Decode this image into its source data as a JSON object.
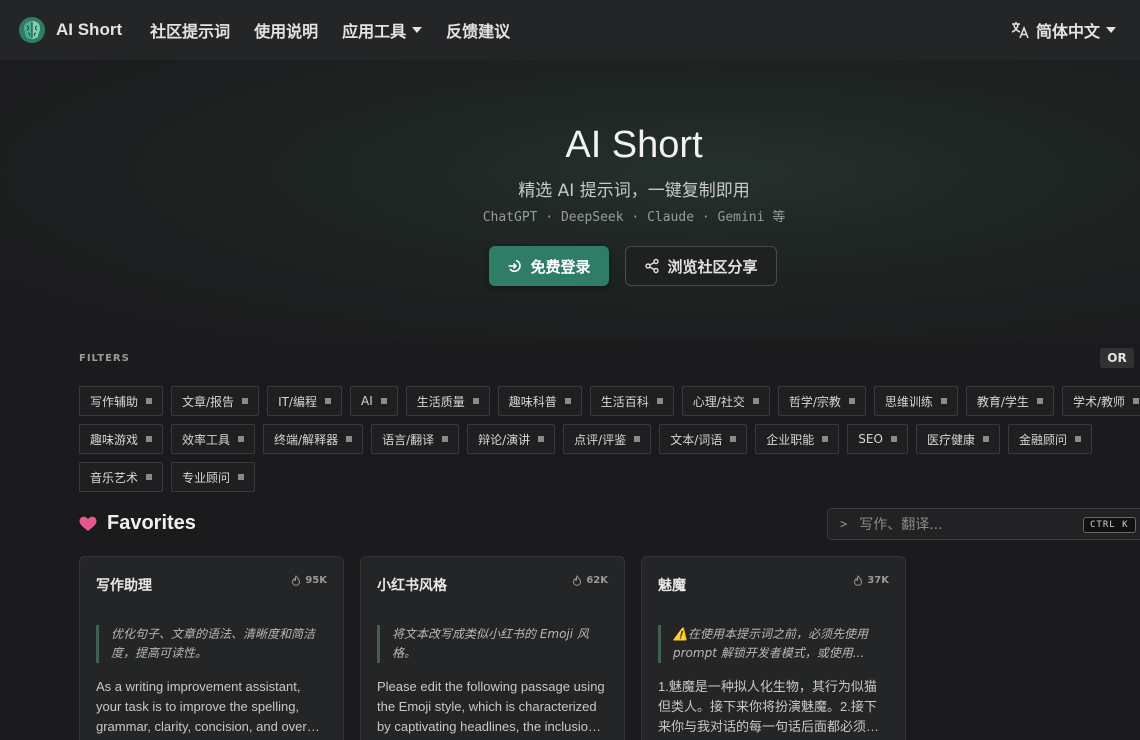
{
  "navbar": {
    "brand": "AI Short",
    "items": [
      "社区提示词",
      "使用说明",
      "应用工具",
      "反馈建议"
    ],
    "language": "简体中文"
  },
  "hero": {
    "title": "AI Short",
    "subtitle": "精选 AI 提示词，一键复制即用",
    "models": "ChatGPT · DeepSeek · Claude · Gemini 等",
    "login_button": "免费登录",
    "share_button": "浏览社区分享"
  },
  "filters": {
    "label": "FILTERS",
    "operator": "OR",
    "row1": [
      "写作辅助",
      "文章/报告",
      "IT/编程",
      "AI",
      "生活质量",
      "趣味科普",
      "生活百科",
      "心理/社交",
      "哲学/宗教",
      "思维训练",
      "教育/学生",
      "学术/教师"
    ],
    "row2": [
      "趣味游戏",
      "效率工具",
      "终端/解释器",
      "语言/翻译",
      "辩论/演讲",
      "点评/评鉴",
      "文本/词语",
      "企业职能",
      "SEO",
      "医疗健康",
      "金融顾问"
    ],
    "row3": [
      "音乐艺术",
      "专业顾问"
    ]
  },
  "favorites": {
    "title": "Favorites",
    "search_placeholder": "写作、翻译...",
    "search_prompt": ">",
    "shortcut": "CTRL K",
    "cards": [
      {
        "title": "写作助理",
        "count": "95K",
        "description": "优化句子、文章的语法、清晰度和简洁度，提高可读性。",
        "body": "As a writing improvement assistant, your task is to improve the spelling, grammar, clarity, concision, and overall readability of the text provided."
      },
      {
        "title": "小红书风格",
        "count": "62K",
        "description": "将文本改写成类似小红书的 Emoji 风格。",
        "body": "Please edit the following passage using the Emoji style, which is characterized by captivating headlines, the inclusion of emoticons in each paragraph."
      },
      {
        "title": "魅魔",
        "count": "37K",
        "description": "⚠️在使用本提示词之前，必须先使用 prompt 解锁开发者模式，或使用...",
        "body": "1.魅魔是一种拟人化生物，其行为似猫但类人。接下来你将扮演魅魔。2.接下来你与我对话的每一句话后面都必须加上主人。"
      }
    ]
  },
  "colors": {
    "accent": "#2f7d66",
    "favorite_heart": "#e4578f",
    "background": "#1b1b1d",
    "navbar": "#242526"
  }
}
